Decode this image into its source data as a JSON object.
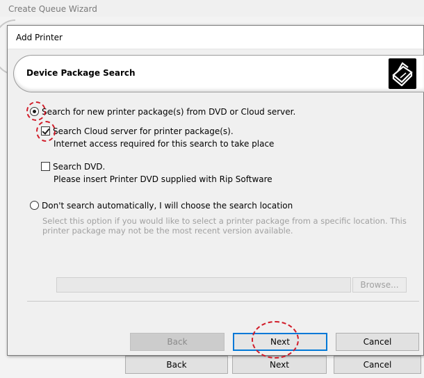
{
  "outer_window": {
    "title": "Create Queue Wizard",
    "buttons": {
      "back": "Back",
      "next": "Next",
      "cancel": "Cancel"
    }
  },
  "dialog": {
    "title": "Add Printer",
    "banner": {
      "title": "Device Package Search",
      "icon": "printer-icon"
    },
    "options": {
      "search_new": {
        "label": "Search for new printer package(s) from DVD or Cloud server.",
        "selected": true
      },
      "search_cloud": {
        "label": "Search Cloud server for printer package(s).",
        "sub": "Internet access required for this search to take place",
        "checked": true
      },
      "search_dvd": {
        "label": "Search DVD.",
        "sub": "Please insert Printer DVD supplied with Rip Software",
        "checked": false
      },
      "manual": {
        "label": "Don't search automatically, I will choose the search location",
        "description_line1": "Select this option if you would like to select a printer package from a specific location. This",
        "description_line2": "printer package may not be the most recent version available.",
        "selected": false
      }
    },
    "path_field": {
      "value": ""
    },
    "browse_label": "Browse...",
    "buttons": {
      "back": "Back",
      "next": "Next",
      "cancel": "Cancel"
    }
  },
  "colors": {
    "accent": "#0078d7",
    "highlight": "#d11d2a",
    "disabled_text": "#a0a0a0"
  }
}
